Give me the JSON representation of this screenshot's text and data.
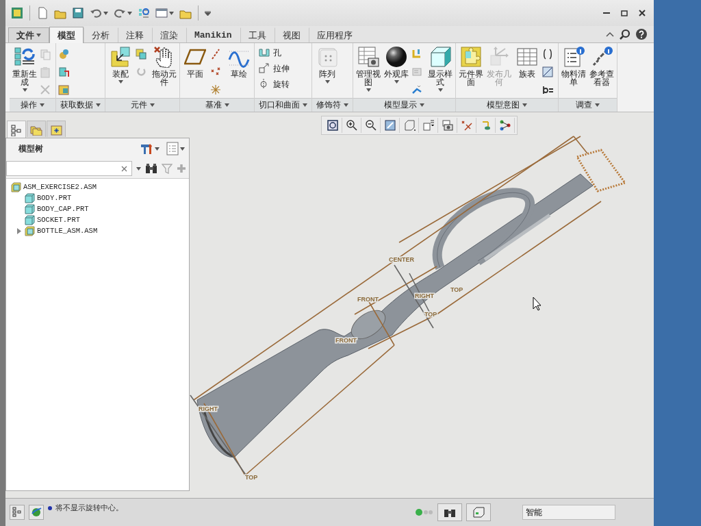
{
  "tabs": [
    {
      "label": "文件",
      "kind": "menu",
      "selected": false
    },
    {
      "label": "模型",
      "kind": "tab",
      "selected": true
    },
    {
      "label": "分析",
      "kind": "tab",
      "selected": false
    },
    {
      "label": "注释",
      "kind": "tab",
      "selected": false
    },
    {
      "label": "渲染",
      "kind": "tab",
      "selected": false
    },
    {
      "label": "Manikin",
      "kind": "tab",
      "selected": false
    },
    {
      "label": "工具",
      "kind": "tab",
      "selected": false
    },
    {
      "label": "视图",
      "kind": "tab",
      "selected": false
    },
    {
      "label": "应用程序",
      "kind": "tab",
      "selected": false
    }
  ],
  "ribbon_groups": [
    {
      "label": "操作",
      "items": [
        {
          "kind": "large",
          "label": "重新生成",
          "dropdown": true,
          "disabled": false
        },
        {
          "kind": "column",
          "disabled": true
        }
      ]
    },
    {
      "label": "获取数据",
      "items": [
        {
          "kind": "column",
          "disabled": false
        }
      ]
    },
    {
      "label": "元件",
      "items": [
        {
          "kind": "large",
          "label": "装配",
          "dropdown": true,
          "disabled": false
        },
        {
          "kind": "column",
          "disabled": false
        },
        {
          "kind": "large",
          "label": "拖动元件",
          "dropdown": false,
          "disabled": false
        }
      ]
    },
    {
      "label": "基准",
      "items": [
        {
          "kind": "large",
          "label": "平面",
          "dropdown": false,
          "disabled": false
        },
        {
          "kind": "column",
          "disabled": false
        },
        {
          "kind": "large",
          "label": "草绘",
          "dropdown": false,
          "disabled": false
        }
      ]
    },
    {
      "label": "切口和曲面",
      "items": [
        {
          "kind": "rows",
          "labels": [
            "孔",
            "拉伸",
            "旋转"
          ],
          "disabled": false
        }
      ]
    },
    {
      "label": "修饰符",
      "items": [
        {
          "kind": "large",
          "label": "阵列",
          "dropdown": true,
          "disabled": false
        }
      ]
    },
    {
      "label": "模型显示",
      "items": [
        {
          "kind": "large",
          "label": "管理视图",
          "dropdown": true,
          "disabled": false
        },
        {
          "kind": "large",
          "label": "外观库",
          "dropdown": true,
          "disabled": false
        },
        {
          "kind": "column",
          "disabled": false
        },
        {
          "kind": "large",
          "label": "显示样式",
          "dropdown": true,
          "disabled": false
        }
      ]
    },
    {
      "label": "模型意图",
      "items": [
        {
          "kind": "large",
          "label": "元件界面",
          "dropdown": false,
          "disabled": false
        },
        {
          "kind": "large",
          "label": "发布几何",
          "dropdown": false,
          "disabled": true
        },
        {
          "kind": "large",
          "label": "族表",
          "dropdown": false,
          "disabled": false
        },
        {
          "kind": "column",
          "disabled": false
        }
      ]
    },
    {
      "label": "调查",
      "items": [
        {
          "kind": "large",
          "label": "物料清单",
          "dropdown": false,
          "disabled": false
        },
        {
          "kind": "large",
          "label": "参考查看器",
          "dropdown": false,
          "disabled": false
        }
      ]
    }
  ],
  "panel_tabs": [
    {
      "selected": true
    },
    {
      "selected": false
    },
    {
      "selected": false
    }
  ],
  "model_tree": {
    "title": "模型树",
    "items": [
      {
        "label": "ASM_EXERCISE2.ASM",
        "kind": "assembly",
        "expanded": true,
        "children": [
          {
            "label": "BODY.PRT",
            "kind": "part"
          },
          {
            "label": "BODY_CAP.PRT",
            "kind": "part"
          },
          {
            "label": "SOCKET.PRT",
            "kind": "part"
          },
          {
            "label": "BOTTLE_ASM.ASM",
            "kind": "assembly",
            "expanded": false
          }
        ]
      }
    ]
  },
  "viewport": {
    "datum_labels": [
      "CENTER",
      "FRONT",
      "RIGHT",
      "TOP",
      "TOP",
      "FRONT",
      "RIGHT",
      "TOP"
    ]
  },
  "status_bar": {
    "message": "将不显示旋转中心。",
    "filter": "智能"
  }
}
